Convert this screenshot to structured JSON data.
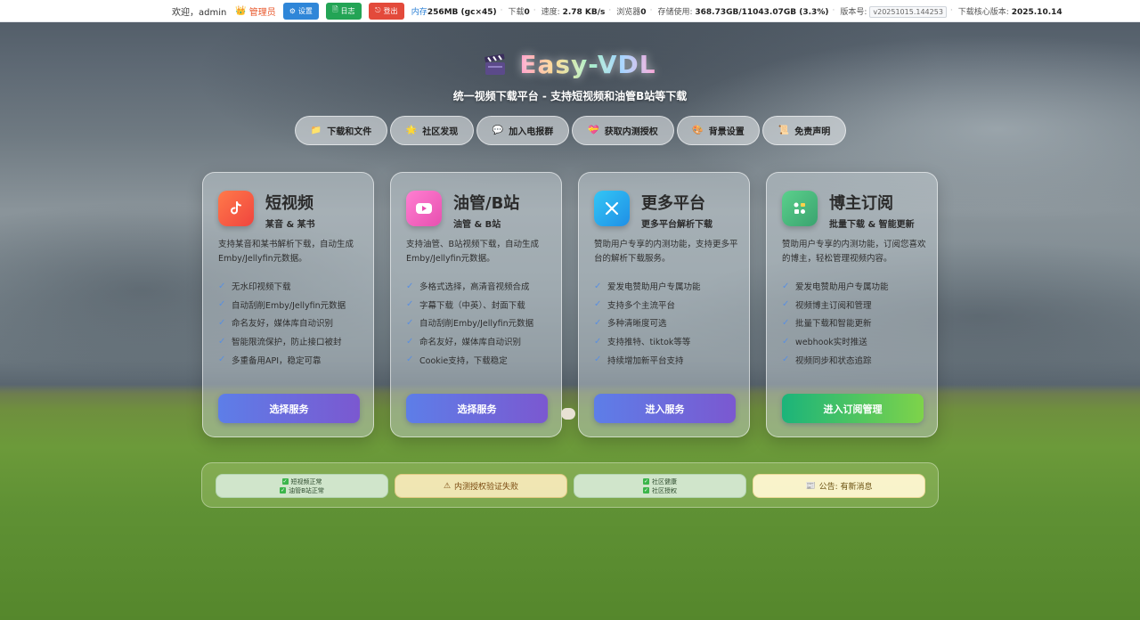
{
  "topbar": {
    "greeting": "欢迎，admin",
    "role": "管理员",
    "settings_label": "设置",
    "log_label": "日志",
    "logout_label": "登出",
    "memory_label": "内存",
    "memory_value": "256MB (gc×45)",
    "download_label": "下载",
    "download_value": "0",
    "speed_label": "速度",
    "speed_value": "2.78 KB/s",
    "browser_label": "浏览器",
    "browser_value": "0",
    "storage_label": "存储使用:",
    "storage_value": "368.73GB/11043.07GB (3.3%)",
    "version_label": "版本号:",
    "version_value": "v20251015.144253",
    "core_label": "下载核心版本:",
    "core_value": "2025.10.14"
  },
  "header": {
    "title": "Easy-VDL",
    "subtitle": "统一视频下载平台 - 支持短视频和油管B站等下载"
  },
  "nav": [
    {
      "label": "下载和文件",
      "icon": "folder-icon",
      "glyph": "📁"
    },
    {
      "label": "社区发现",
      "icon": "sun-icon",
      "glyph": "🌟"
    },
    {
      "label": "加入电报群",
      "icon": "chat-icon",
      "glyph": "💬"
    },
    {
      "label": "获取内测授权",
      "icon": "heart-icon",
      "glyph": "💝"
    },
    {
      "label": "背景设置",
      "icon": "palette-icon",
      "glyph": "🎨"
    },
    {
      "label": "免责声明",
      "icon": "scroll-icon",
      "glyph": "📜"
    }
  ],
  "cards": [
    {
      "title": "短视频",
      "subtitle": "某音 & 某书",
      "desc": "支持某音和某书解析下载，自动生成Emby/Jellyfin元数据。",
      "features": [
        "无水印视频下载",
        "自动刮削Emby/Jellyfin元数据",
        "命名友好，媒体库自动识别",
        "智能限流保护，防止接口被封",
        "多重备用API，稳定可靠"
      ],
      "button": "选择服务",
      "icon": "tiktok-icon",
      "color": "#f0604a"
    },
    {
      "title": "油管/B站",
      "subtitle": "油管 & B站",
      "desc": "支持油管、B站视频下载，自动生成Emby/Jellyfin元数据。",
      "features": [
        "多格式选择，高清音视频合成",
        "字幕下载（中英）、封面下载",
        "自动刮削Emby/Jellyfin元数据",
        "命名友好，媒体库自动识别",
        "Cookie支持，下载稳定"
      ],
      "button": "选择服务",
      "icon": "youtube-icon",
      "color": "#f35fbf"
    },
    {
      "title": "更多平台",
      "subtitle": "更多平台解析下载",
      "desc": "赞助用户专享的内测功能，支持更多平台的解析下载服务。",
      "features": [
        "爱发电赞助用户专属功能",
        "支持多个主流平台",
        "多种清晰度可选",
        "支持推特、tiktok等等",
        "持续增加新平台支持"
      ],
      "button": "进入服务",
      "icon": "x-logo-icon",
      "color": "#2aa8f2"
    },
    {
      "title": "博主订阅",
      "subtitle": "批量下载 & 智能更新",
      "desc": "赞助用户专享的内测功能，订阅您喜欢的博主，轻松管理视频内容。",
      "features": [
        "爱发电赞助用户专属功能",
        "视频博主订阅和管理",
        "批量下载和智能更新",
        "webhook实时推送",
        "视频同步和状态追踪"
      ],
      "button": "进入订阅管理",
      "icon": "subscription-icon",
      "color": "#4cc38a"
    }
  ],
  "status": {
    "box1": [
      "短视频正常",
      "油管B站正常"
    ],
    "box2": "内测授权验证失败",
    "box3": [
      "社区健康",
      "社区授权"
    ],
    "box4": "公告: 有新消息"
  }
}
